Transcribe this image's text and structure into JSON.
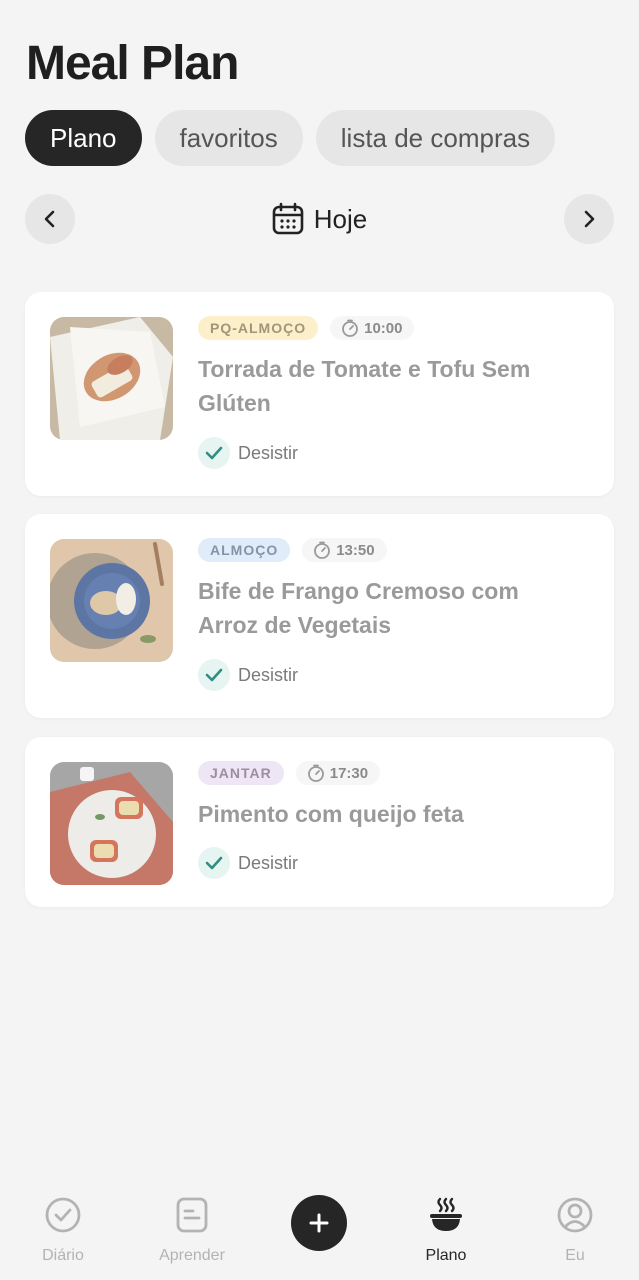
{
  "header": {
    "title": "Meal Plan"
  },
  "tabs": [
    {
      "label": "Plano",
      "active": true
    },
    {
      "label": "favoritos",
      "active": false
    },
    {
      "label": "lista de compras",
      "active": false
    }
  ],
  "date_nav": {
    "label": "Hoje",
    "prev_icon": "chevron-left-icon",
    "next_icon": "chevron-right-icon",
    "calendar_icon": "calendar-icon"
  },
  "meals": [
    {
      "type": "PQ-ALMOÇO",
      "type_color": "#fbf0c9",
      "type_text_color": "#a3957a",
      "time": "10:00",
      "name": "Torrada de Tomate e Tofu Sem Glúten",
      "status": "Desistir"
    },
    {
      "type": "ALMOÇO",
      "type_color": "#e0ecfa",
      "type_text_color": "#8494a8",
      "time": "13:50",
      "name": "Bife de Frango Cremoso com Arroz de Vegetais",
      "status": "Desistir"
    },
    {
      "type": "JANTAR",
      "type_color": "#eee6f4",
      "type_text_color": "#9a8da4",
      "time": "17:30",
      "name": "Pimento com queijo feta",
      "status": "Desistir"
    }
  ],
  "bottom_nav": {
    "items": [
      {
        "label": "Diário",
        "icon": "check-circle-icon",
        "active": false
      },
      {
        "label": "Aprender",
        "icon": "note-icon",
        "active": false
      },
      {
        "label": "Plano",
        "icon": "bowl-icon",
        "active": true
      },
      {
        "label": "Eu",
        "icon": "user-icon",
        "active": false
      }
    ],
    "add_icon": "plus-icon"
  },
  "colors": {
    "accent_dark": "#262626",
    "check": "#2e8f83",
    "background": "#f4f4f4"
  }
}
